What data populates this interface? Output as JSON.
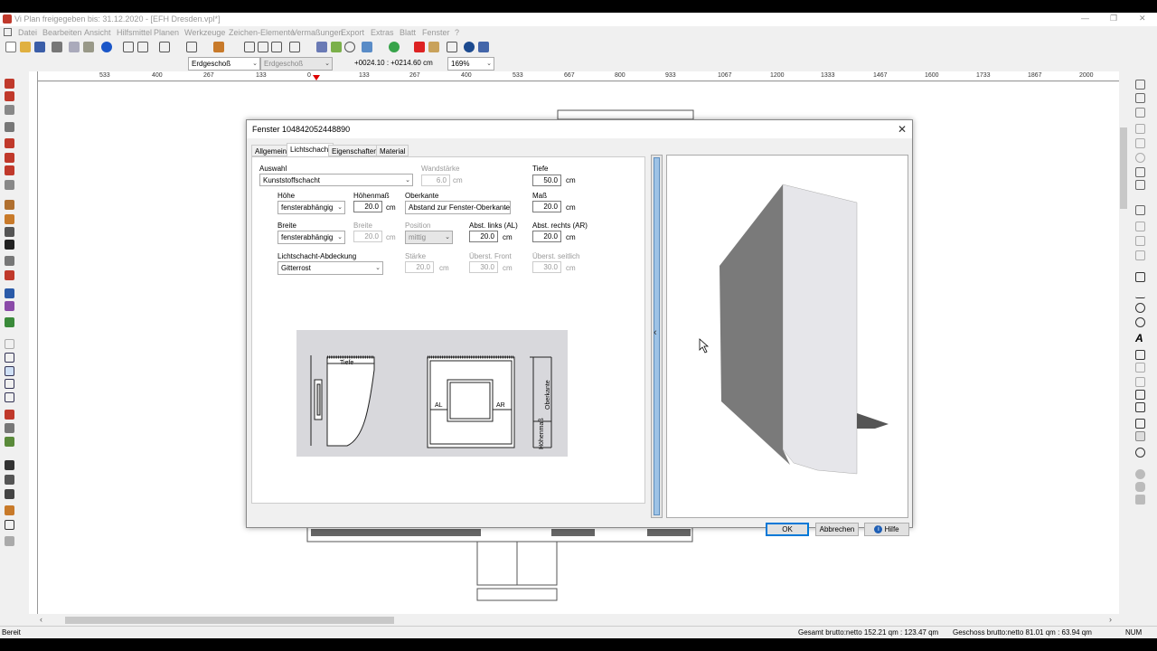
{
  "window": {
    "title": "Vi Plan freigegeben bis: 31.12.2020 - [EFH Dresden.vpl*]",
    "controls": [
      "—",
      "❐",
      "✕"
    ]
  },
  "menu": [
    "Datei",
    "Bearbeiten",
    "Ansicht",
    "Hilfsmittel",
    "Planen",
    "Werkzeuge",
    "Zeichen-Elemente",
    "Vermaßungen",
    "Export",
    "Extras",
    "Blatt",
    "Fenster",
    "?"
  ],
  "optionbar": {
    "floor1": "Erdgeschoß",
    "floor2": "Erdgeschoß",
    "coords": "+0024.10 : +0214.60 cm",
    "zoom": "169%"
  },
  "ruler": [
    "533",
    "400",
    "267",
    "133",
    "0",
    "133",
    "267",
    "400",
    "533",
    "667",
    "800",
    "933",
    "1067",
    "1200",
    "1333",
    "1467",
    "1600",
    "1733",
    "1867",
    "2000"
  ],
  "status": {
    "left": "Bereit",
    "gesamt": "Gesamt brutto:netto 152.21 qm : 123.47 qm",
    "geschoss": "Geschoss brutto:netto 81.01 qm : 63.94 qm",
    "num": "NUM"
  },
  "dialog": {
    "title": "Fenster 104842052448890",
    "tabs": [
      "Allgemein",
      "Lichtschacht",
      "Eigenschaften",
      "Material"
    ],
    "active_tab": "Lichtschacht",
    "auswahl_label": "Auswahl",
    "auswahl_value": "Kunststoffschacht",
    "wandstaerke_label": "Wandstärke",
    "wandstaerke_value": "6.0",
    "tiefe_label": "Tiefe",
    "tiefe_value": "50.0",
    "hoehe_label": "Höhe",
    "hoehe_value": "fensterabhängig",
    "hoehenmass_label": "Höhenmaß",
    "hoehenmass_value": "20.0",
    "oberkante_label": "Oberkante",
    "oberkante_value": "Abstand zur Fenster-Oberkante",
    "mass_label": "Maß",
    "mass_value": "20.0",
    "breite_label": "Breite",
    "breite_value": "fensterabhängig",
    "breite2_label": "Breite",
    "breite2_value": "20.0",
    "position_label": "Position",
    "position_value": "mittig",
    "abst_links_label": "Abst. links (AL)",
    "abst_links_value": "20.0",
    "abst_rechts_label": "Abst. rechts (AR)",
    "abst_rechts_value": "20.0",
    "abdeckung_label": "Lichtschacht-Abdeckung",
    "abdeckung_value": "Gitterrost",
    "staerke_label": "Stärke",
    "staerke_value": "20.0",
    "ueberst_front_label": "Überst. Front",
    "ueberst_front_value": "30.0",
    "ueberst_seitlich_label": "Überst. seitlich",
    "ueberst_seitlich_value": "30.0",
    "unit": "cm",
    "sketch": {
      "tiefe": "Tiefe",
      "al": "AL",
      "ar": "AR",
      "oberkante": "Oberkante",
      "hoehenmass": "Höhenmaß"
    },
    "collapse_arrow": "‹",
    "ok": "OK",
    "abbrechen": "Abbrechen",
    "hilfe": "Hilfe"
  }
}
